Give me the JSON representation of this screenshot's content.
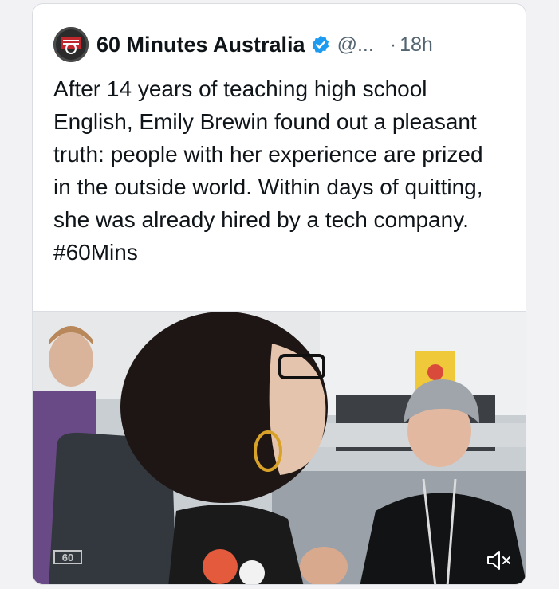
{
  "tweet": {
    "author_name": "60 Minutes Australia",
    "handle": "@...",
    "separator": "·",
    "time": "18h",
    "text": "After 14 years of teaching high school English, Emily Brewin found out a pleasant truth: people with her experience are prized in the outside world. Within days of quitting, she was already hired by a tech company.",
    "hashtag": "#60Mins"
  },
  "media": {
    "type": "video",
    "watermark_logo": "60",
    "mute_icon": "volume-muted-icon"
  },
  "colors": {
    "text": "#0f1419",
    "secondary": "#536471",
    "verified": "#1d9bf0",
    "border": "#d9dde1"
  }
}
